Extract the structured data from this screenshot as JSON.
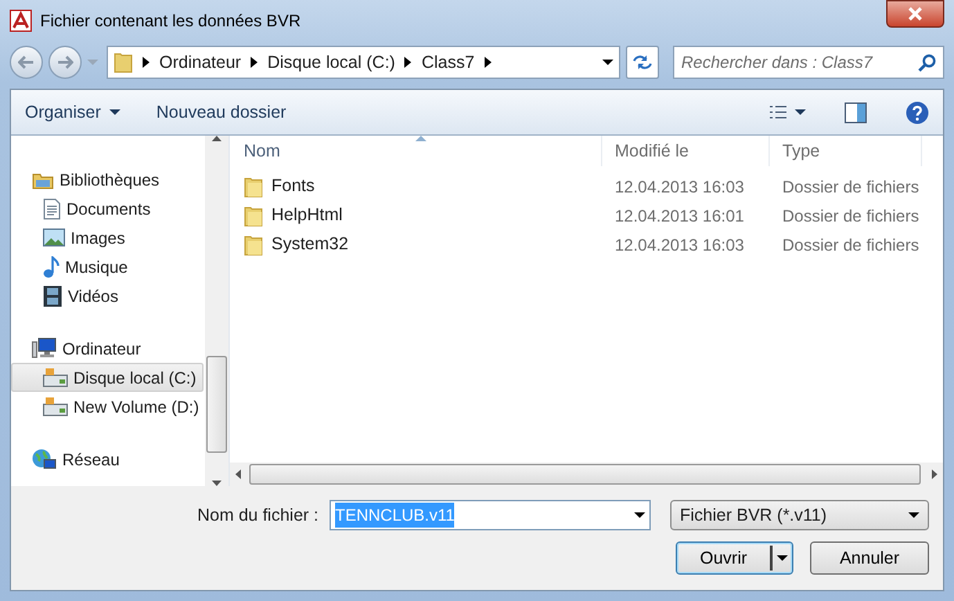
{
  "window": {
    "title": "Fichier contenant les données BVR"
  },
  "address_bar": {
    "path": [
      "Ordinateur",
      "Disque local (C:)",
      "Class7"
    ]
  },
  "search": {
    "placeholder": "Rechercher dans : Class7"
  },
  "toolbar": {
    "buttons": [
      "Organiser",
      "Nouveau dossier"
    ]
  },
  "sidebar": {
    "items": [
      {
        "label": "Bibliothèques",
        "kind": "library",
        "selected": false,
        "children": [
          {
            "label": "Documents",
            "kind": "document",
            "selected": false
          },
          {
            "label": "Images",
            "kind": "image",
            "selected": false
          },
          {
            "label": "Musique",
            "kind": "music",
            "selected": false
          },
          {
            "label": "Vidéos",
            "kind": "video",
            "selected": false
          }
        ]
      },
      {
        "label": "Ordinateur",
        "kind": "computer",
        "selected": false,
        "children": [
          {
            "label": "Disque local (C:)",
            "kind": "drive",
            "selected": true
          },
          {
            "label": "New Volume (D:)",
            "kind": "drive",
            "selected": false
          }
        ]
      },
      {
        "label": "Réseau",
        "kind": "network",
        "selected": false
      }
    ]
  },
  "table": {
    "columns": [
      {
        "label": "Nom",
        "sorted": true
      },
      {
        "label": "Modifié le",
        "sorted": false
      },
      {
        "label": "Type",
        "sorted": false
      }
    ],
    "rows": [
      {
        "name": "Fonts",
        "modified": "12.04.2013 16:03",
        "type": "Dossier de fichiers",
        "selected": false
      },
      {
        "name": "HelpHtml",
        "modified": "12.04.2013 16:01",
        "type": "Dossier de fichiers",
        "selected": false
      },
      {
        "name": "System32",
        "modified": "12.04.2013 16:03",
        "type": "Dossier de fichiers",
        "selected": false
      }
    ]
  },
  "file_name": {
    "label": "Nom du fichier :",
    "value": "TENNCLUB.v11",
    "text_selected": true
  },
  "file_type": {
    "value": "Fichier BVR (*.v11)"
  },
  "buttons": [
    {
      "label": "Ouvrir",
      "kind": "split",
      "default": true
    },
    {
      "label": "Annuler",
      "kind": "plain",
      "default": false
    }
  ]
}
